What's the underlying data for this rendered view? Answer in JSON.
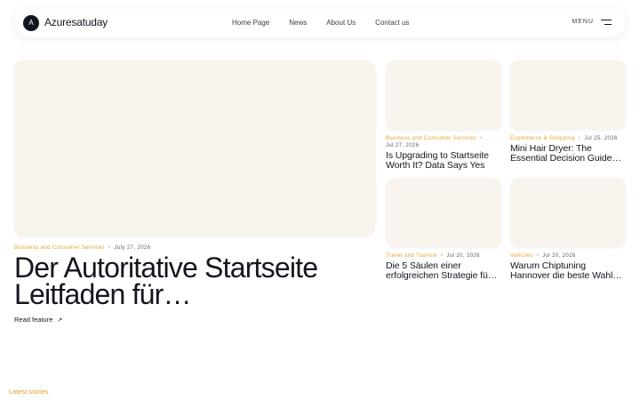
{
  "brand": {
    "mark": "A",
    "name": "Azuresatuday"
  },
  "nav": {
    "links": [
      "Home Page",
      "News",
      "About Us",
      "Contact us"
    ],
    "menu_label": "MENU"
  },
  "hero": {
    "category": "Business and Consumer Services",
    "separator": "•",
    "date": "July 27, 2026",
    "title": "Der Autoritative Startseite Leitfaden für…",
    "cta": "Read feature",
    "cta_icon": "arrow-up-right-icon"
  },
  "cards": [
    {
      "category": "Business and Consumer Services",
      "date": "Jul 27, 2026",
      "title": "Is Upgrading to Startseite Worth It? Data Says Yes"
    },
    {
      "category": "Ecommerce & Shopping",
      "date": "Jul 25, 2026",
      "title": "Mini Hair Dryer: The Essential Decision Guide…"
    },
    {
      "category": "Travel and Tourism",
      "date": "Jul 20, 2026",
      "title": "Die 5 Säulen einer erfolgreichen Strategie fü…"
    },
    {
      "category": "Vehicles",
      "date": "Jul 20, 2026",
      "title": "Warum Chiptuning Hannover die beste Wahl…"
    }
  ],
  "section": {
    "latest_label": "Latest stories"
  },
  "colors": {
    "accent": "#e0a02a",
    "placeholder": "#f8f3ec",
    "text": "#14161f"
  }
}
